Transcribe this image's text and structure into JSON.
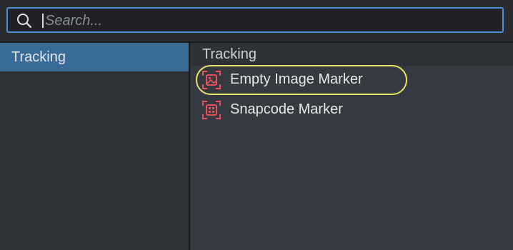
{
  "search": {
    "placeholder": "Search...",
    "icon": "search-icon"
  },
  "categories": [
    {
      "label": "Tracking",
      "selected": true
    }
  ],
  "results": {
    "section_title": "Tracking",
    "items": [
      {
        "label": "Empty Image Marker",
        "icon": "image-marker-icon",
        "highlighted": true
      },
      {
        "label": "Snapcode Marker",
        "icon": "snapcode-marker-icon",
        "highlighted": false
      }
    ]
  },
  "colors": {
    "accent": "#4a8fd6",
    "selection": "#3a6c97",
    "icon": "#e8505b",
    "highlight": "#e9e26c"
  }
}
